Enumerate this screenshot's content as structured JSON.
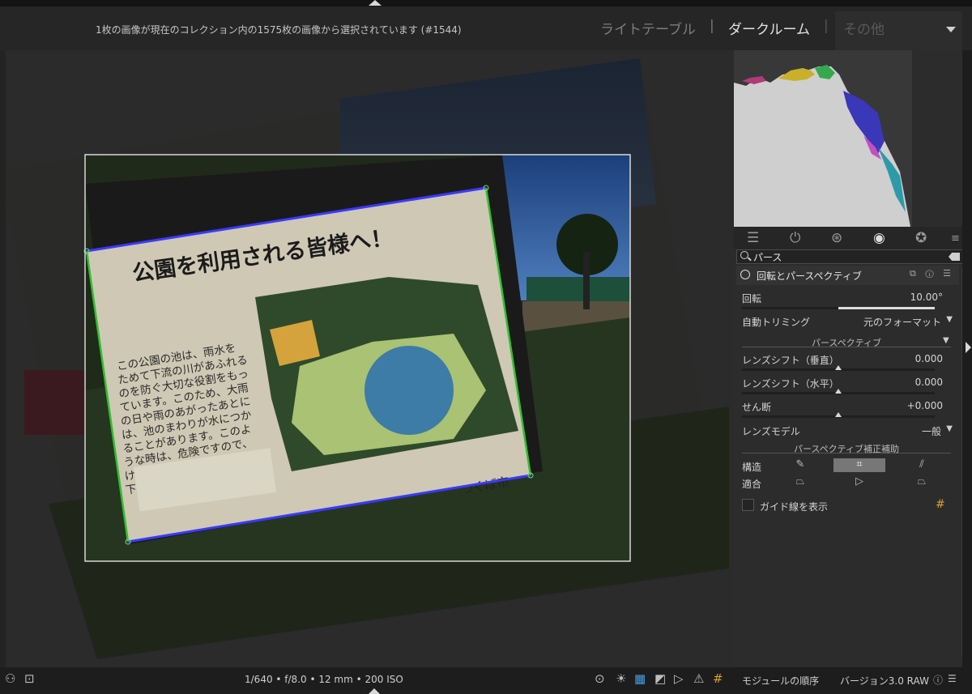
{
  "header": {
    "selection_info": "1枚の画像が現在のコレクション内の1575枚の画像から選択されています (#1544)",
    "views": {
      "lighttable": "ライトテーブル",
      "separator": "|",
      "darkroom": "ダークルーム",
      "other": "その他"
    }
  },
  "photo": {
    "sign_title": "公園を利用される皆様へ！",
    "sign_text": [
      "この公園の池は、雨水を",
      "ためて下流の川があふれる",
      "のを防ぐ大切な役割をもっ",
      "ています。このため、大雨",
      "の日や雨のあがったあとに",
      "は、池のまわりが水につか",
      "ることがあります。このよ",
      "うな時は、危険ですので、",
      "けっして水に近づかないで",
      "下さい。"
    ],
    "sign_city": "つくば市"
  },
  "footer": {
    "exif": "1/640 • f/8.0 • 12 mm • 200 ISO",
    "module_order_label": "モジュールの順序",
    "module_order_value": "バージョン3.0 RAW"
  },
  "panel": {
    "search": {
      "value": "パース",
      "placeholder": ""
    },
    "module_title": "回転とパースペクティブ",
    "rotation": {
      "label": "回転",
      "value": "10.00°",
      "fraction": 0.5
    },
    "auto_crop": {
      "label": "自動トリミング",
      "value": "元のフォーマット"
    },
    "perspective_section": "パースペクティブ",
    "lens_shift_v": {
      "label": "レンズシフト（垂直）",
      "value": "0.000"
    },
    "lens_shift_h": {
      "label": "レンズシフト（水平）",
      "value": "0.000"
    },
    "shear": {
      "label": "せん断",
      "value": "+0.000"
    },
    "lens_model": {
      "label": "レンズモデル",
      "value": "一般"
    },
    "assist_section": "パースペクティブ補正補助",
    "structure_label": "構造",
    "fit_label": "適合",
    "guides_label": "ガイド線を表示"
  },
  "colors": {
    "accent_green": "#2fbf2f",
    "accent_blue": "#3a3aff",
    "panel_bg": "#2c2c2c",
    "canvas_bg": "#2b2b2b"
  }
}
